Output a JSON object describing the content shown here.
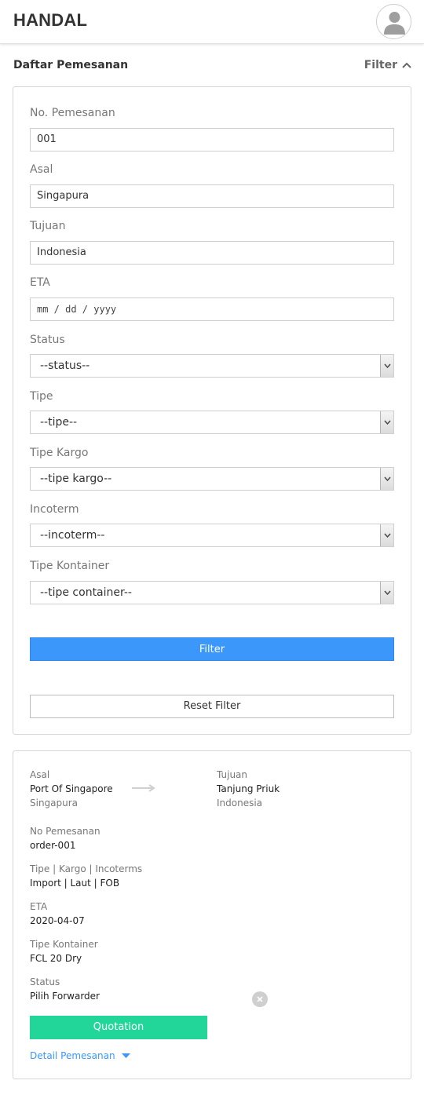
{
  "header": {
    "brand": "HANDAL",
    "avatar_icon": "user-avatar-icon"
  },
  "section": {
    "title": "Daftar Pemesanan",
    "filter_toggle": "Filter"
  },
  "filter_form": {
    "no_pemesanan": {
      "label": "No. Pemesanan",
      "value": "001"
    },
    "asal": {
      "label": "Asal",
      "value": "Singapura"
    },
    "tujuan": {
      "label": "Tujuan",
      "value": "Indonesia"
    },
    "eta": {
      "label": "ETA",
      "placeholder": "mm / dd / yyyy"
    },
    "status": {
      "label": "Status",
      "value": "--status--"
    },
    "tipe": {
      "label": "Tipe",
      "value": "--tipe--"
    },
    "tipe_kargo": {
      "label": "Tipe Kargo",
      "value": "--tipe kargo--"
    },
    "incoterm": {
      "label": "Incoterm",
      "value": "--incoterm--"
    },
    "tipe_kontainer": {
      "label": "Tipe Kontainer",
      "value": "--tipe container--"
    },
    "filter_button": "Filter",
    "reset_button": "Reset Filter"
  },
  "order": {
    "origin": {
      "label": "Asal",
      "port": "Port Of Singapore",
      "country": "Singapura"
    },
    "destination": {
      "label": "Tujuan",
      "port": "Tanjung Priuk",
      "country": "Indonesia"
    },
    "no_pemesanan": {
      "label": "No Pemesanan",
      "value": "order-001"
    },
    "tipe_kargo_incoterms": {
      "label": "Tipe | Kargo | Incoterms",
      "value": "Import | Laut | FOB"
    },
    "eta": {
      "label": "ETA",
      "value": "2020-04-07"
    },
    "tipe_kontainer": {
      "label": "Tipe Kontainer",
      "value": "FCL 20 Dry"
    },
    "status": {
      "label": "Status",
      "value": "Pilih Forwarder"
    },
    "quotation_button": "Quotation",
    "detail_link": "Detail Pemesanan"
  },
  "colors": {
    "primary": "#3b97f9",
    "success": "#22d69a",
    "border": "#d6d6d6"
  }
}
